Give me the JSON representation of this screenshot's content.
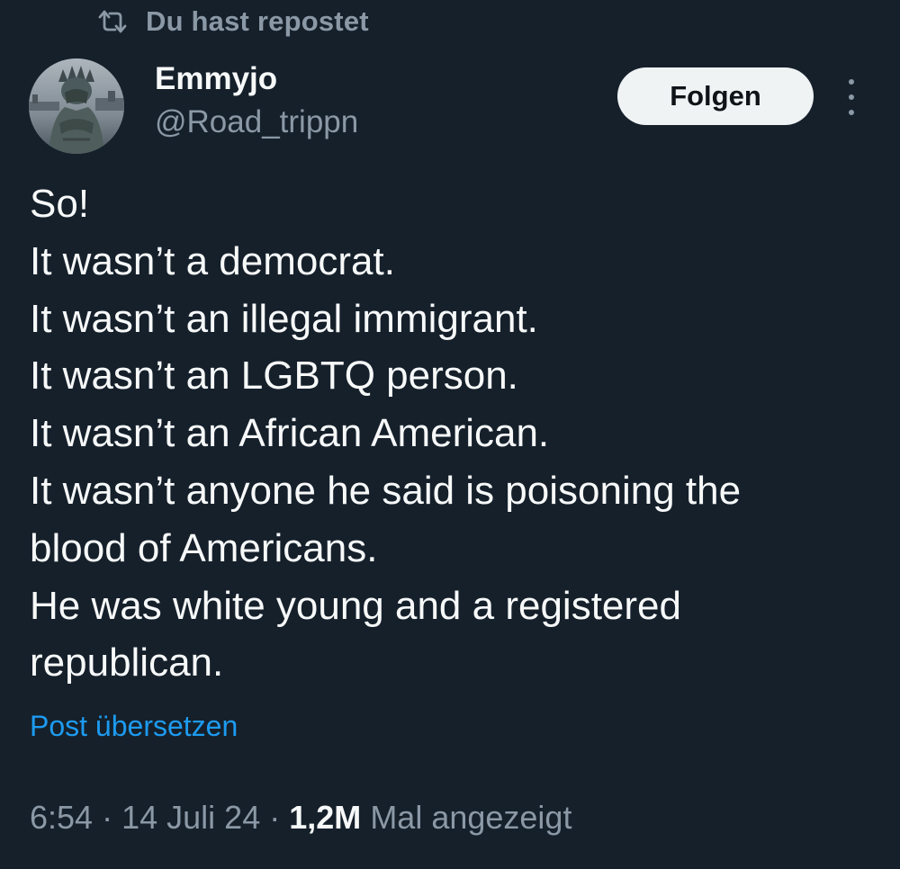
{
  "repost": {
    "label": "Du hast repostet",
    "icon": "repost-icon"
  },
  "author": {
    "display_name": "Emmyjo",
    "handle": "@Road_trippn",
    "avatar": "statue-of-liberty-avatar"
  },
  "follow_button": {
    "label": "Folgen"
  },
  "more_menu": {
    "icon": "more-vertical-icon"
  },
  "post": {
    "lines": [
      "So!",
      "It wasn’t a democrat.",
      "It wasn’t an illegal immigrant.",
      "It wasn’t an LGBTQ person.",
      "It wasn’t an African American.",
      "It wasn’t anyone he said is poisoning the",
      "blood of Americans.",
      "He was white young and a registered",
      "republican."
    ]
  },
  "translate": {
    "label": "Post übersetzen"
  },
  "meta": {
    "time": "6:54",
    "separator": "·",
    "date": "14 Juli 24",
    "views_count": "1,2M",
    "views_label": "Mal angezeigt"
  },
  "colors": {
    "background": "#15202b",
    "primary_text": "#f7f9f9",
    "secondary_text": "#8b98a5",
    "link": "#1d9bf0",
    "button_bg": "#eff3f4",
    "button_text": "#0f1419"
  }
}
